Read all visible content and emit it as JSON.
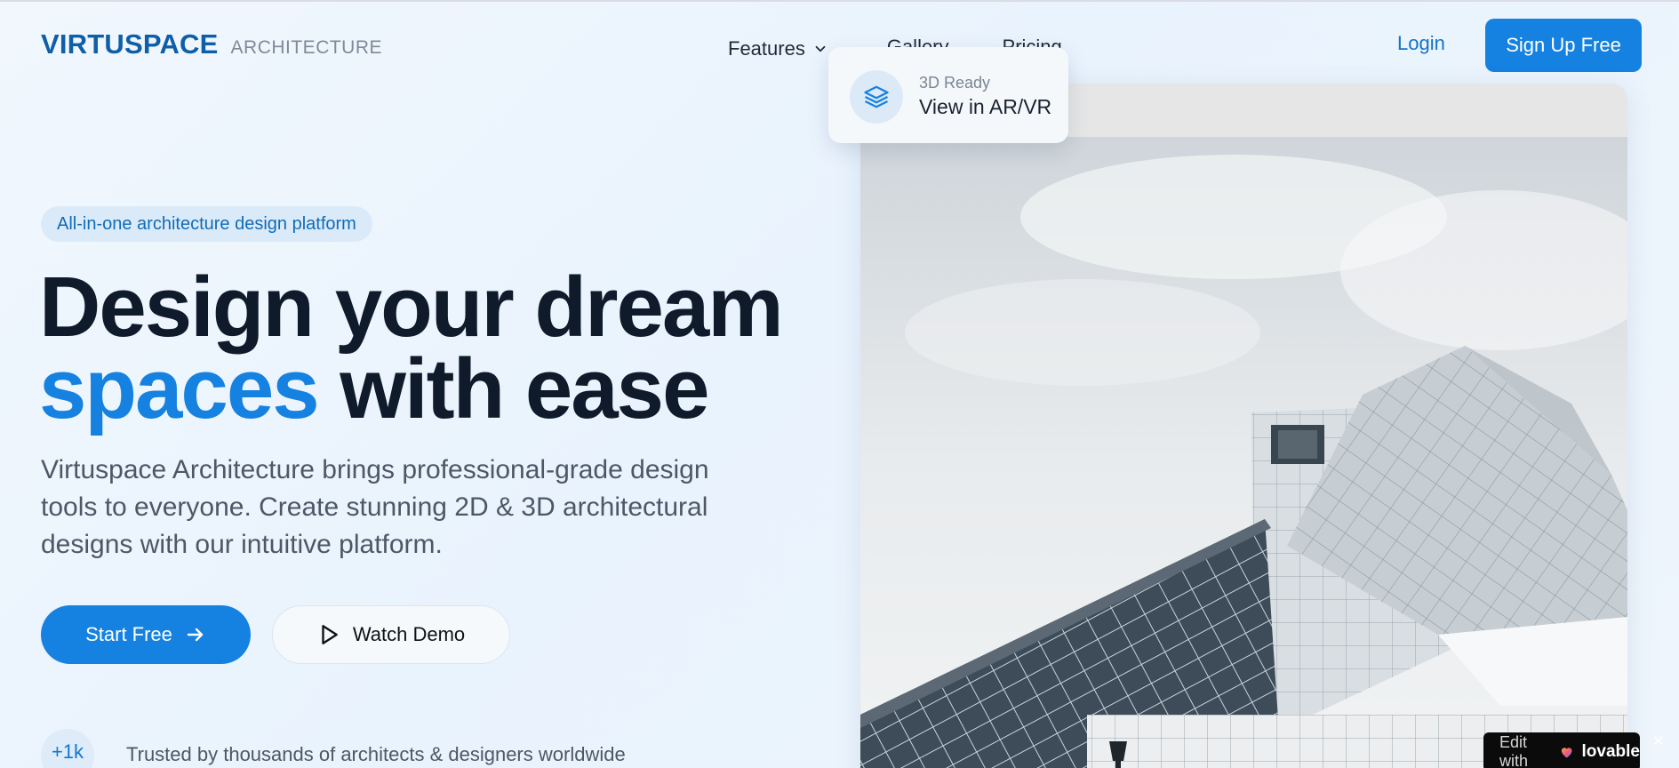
{
  "brand": {
    "name": "VIRTUSPACE",
    "subtitle": "ARCHITECTURE"
  },
  "nav": {
    "links": [
      {
        "label": "Features",
        "icon": "chevron-down-icon"
      },
      {
        "label": "Gallery"
      },
      {
        "label": "Pricing"
      }
    ],
    "login_label": "Login",
    "signup_label": "Sign Up Free"
  },
  "hero": {
    "badge": "All-in-one architecture design platform",
    "headline_line1": "Design your dream",
    "headline_accent": "spaces",
    "headline_rest": "with ease",
    "lead": "Virtuspace Architecture brings professional-grade design tools to everyone. Create stunning 2D & 3D architectural designs with our intuitive platform.",
    "start_label": "Start Free",
    "demo_label": "Watch Demo",
    "trust_count": "+1k",
    "trust_text": "Trusted by thousands of architects & designers worldwide"
  },
  "floating_card": {
    "small": "3D Ready",
    "big": "View in AR/VR",
    "icon": "layers-icon"
  },
  "lovable": {
    "edit_text": "Edit with",
    "brand": "lovable",
    "close": "✕"
  },
  "colors": {
    "accent": "#1581e0",
    "brand": "#0f5ea8",
    "text_dark": "#0f1a2b",
    "text_muted": "#4d5866"
  }
}
